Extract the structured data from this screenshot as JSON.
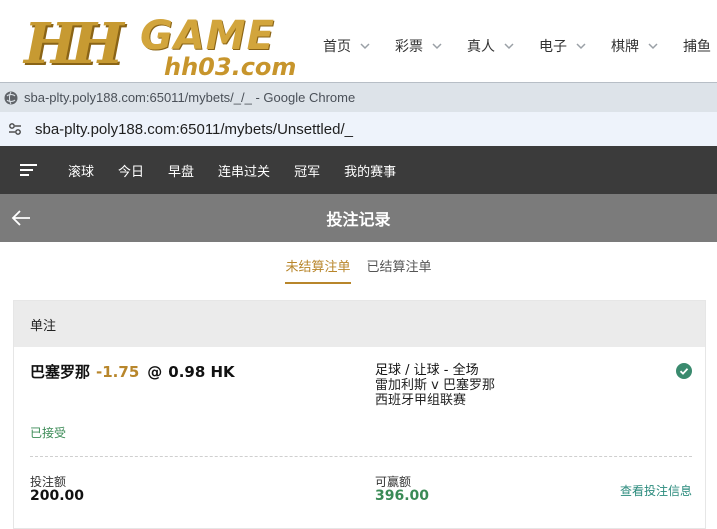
{
  "site": {
    "logo_hh": "HH",
    "logo_game": "GAME",
    "logo_domain": "hh03.com",
    "nav": [
      "首页",
      "彩票",
      "真人",
      "电子",
      "棋牌",
      "捕鱼"
    ]
  },
  "chrome": {
    "window_title": "sba-plty.poly188.com:65011/mybets/_/_ - Google Chrome",
    "url": "sba-plty.poly188.com:65011/mybets/Unsettled/_"
  },
  "app_nav": {
    "tabs": [
      "滚球",
      "今日",
      "早盘",
      "连串过关",
      "冠军",
      "我的赛事"
    ]
  },
  "page": {
    "title": "投注记录",
    "subtabs": [
      {
        "label": "未结算注单",
        "active": true
      },
      {
        "label": "已结算注单",
        "active": false
      }
    ]
  },
  "bet": {
    "section_label": "单注",
    "team": "巴塞罗那",
    "handicap": "-1.75",
    "at": "@",
    "odds": "0.98 HK",
    "market": "足球 / 让球 - 全场",
    "match": "雷加利斯 v 巴塞罗那",
    "league": "西班牙甲组联赛",
    "status": "已接受",
    "stake_label": "投注额",
    "stake": "200.00",
    "win_label": "可赢额",
    "win": "396.00",
    "detail_link": "查看投注信息"
  },
  "colors": {
    "accent_gold": "#b8862b",
    "status_green": "#3a8a55",
    "nav_dark": "#3b3b3b",
    "head_gray": "#7b7b7b"
  }
}
